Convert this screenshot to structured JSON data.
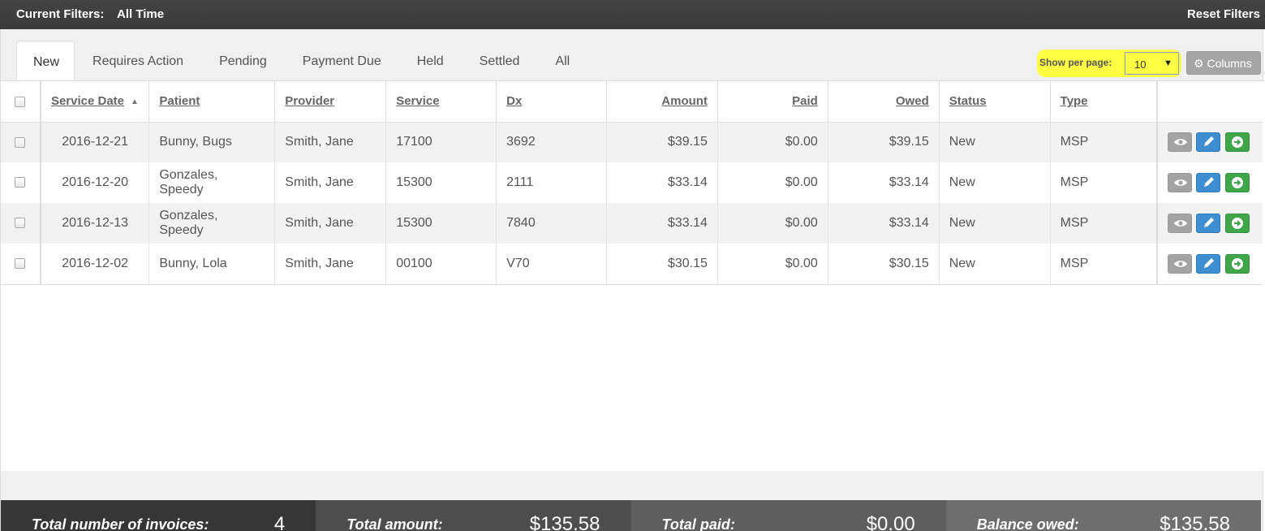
{
  "topbar": {
    "filters_label": "Current Filters:",
    "filters_value": "All Time",
    "reset_label": "Reset Filters"
  },
  "tabs": [
    {
      "label": "New",
      "active": true
    },
    {
      "label": "Requires Action"
    },
    {
      "label": "Pending"
    },
    {
      "label": "Payment Due"
    },
    {
      "label": "Held"
    },
    {
      "label": "Settled"
    },
    {
      "label": "All"
    }
  ],
  "per_page": {
    "label": "Show per page:",
    "value": "10",
    "highlight_color": "#ffff44"
  },
  "columns_button": {
    "label": "Columns",
    "icon": "gear-icon"
  },
  "table": {
    "headers": {
      "service_date": "Service Date",
      "patient": "Patient",
      "provider": "Provider",
      "service": "Service",
      "dx": "Dx",
      "amount": "Amount",
      "paid": "Paid",
      "owed": "Owed",
      "status": "Status",
      "type": "Type"
    },
    "sort_icon": "sort-asc-icon",
    "rows": [
      {
        "service_date": "2016-12-21",
        "patient": "Bunny, Bugs",
        "provider": "Smith, Jane",
        "service": "17100",
        "dx": "3692",
        "amount": "$39.15",
        "paid": "$0.00",
        "owed": "$39.15",
        "status": "New",
        "type": "MSP"
      },
      {
        "service_date": "2016-12-20",
        "patient": "Gonzales, Speedy",
        "provider": "Smith, Jane",
        "service": "15300",
        "dx": "2111",
        "amount": "$33.14",
        "paid": "$0.00",
        "owed": "$33.14",
        "status": "New",
        "type": "MSP"
      },
      {
        "service_date": "2016-12-13",
        "patient": "Gonzales, Speedy",
        "provider": "Smith, Jane",
        "service": "15300",
        "dx": "7840",
        "amount": "$33.14",
        "paid": "$0.00",
        "owed": "$33.14",
        "status": "New",
        "type": "MSP"
      },
      {
        "service_date": "2016-12-02",
        "patient": "Bunny, Lola",
        "provider": "Smith, Jane",
        "service": "00100",
        "dx": "V70",
        "amount": "$30.15",
        "paid": "$0.00",
        "owed": "$30.15",
        "status": "New",
        "type": "MSP"
      }
    ],
    "row_actions": [
      "eye-icon",
      "pencil-icon",
      "arrow-right-circle-icon"
    ],
    "action_colors": {
      "view": "#a3a3a3",
      "edit": "#3d8fd1",
      "go": "#3fa74a"
    }
  },
  "footer": {
    "total_invoices_label": "Total number of invoices:",
    "total_invoices_value": "4",
    "total_amount_label": "Total amount:",
    "total_amount_value": "$135.58",
    "total_paid_label": "Total paid:",
    "total_paid_value": "$0.00",
    "balance_owed_label": "Balance owed:",
    "balance_owed_value": "$135.58"
  }
}
